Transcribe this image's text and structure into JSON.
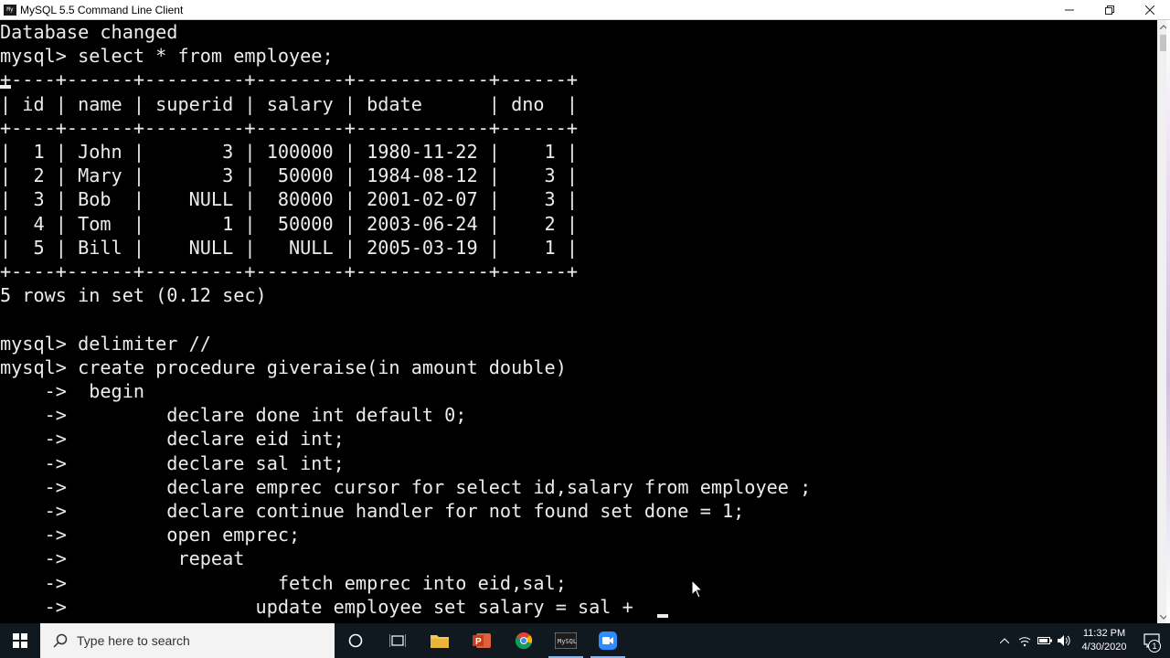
{
  "window": {
    "title": "MySQL 5.5 Command Line Client",
    "icon_label": "My"
  },
  "console": {
    "lines": [
      "Database changed",
      "mysql> select * from employee;",
      "+----+------+---------+--------+------------+------+",
      "| id | name | superid | salary | bdate      | dno  |",
      "+----+------+---------+--------+------------+------+",
      "|  1 | John |       3 | 100000 | 1980-11-22 |    1 |",
      "|  2 | Mary |       3 |  50000 | 1984-08-12 |    3 |",
      "|  3 | Bob  |    NULL |  80000 | 2001-02-07 |    3 |",
      "|  4 | Tom  |       1 |  50000 | 2003-06-24 |    2 |",
      "|  5 | Bill |    NULL |   NULL | 2005-03-19 |    1 |",
      "+----+------+---------+--------+------------+------+",
      "5 rows in set (0.12 sec)",
      "",
      "mysql> delimiter //",
      "mysql> create procedure giveraise(in amount double)",
      "    ->  begin",
      "    ->         declare done int default 0;",
      "    ->         declare eid int;",
      "    ->         declare sal int;",
      "    ->         declare emprec cursor for select id,salary from employee ;",
      "    ->         declare continue handler for not found set done = 1;",
      "    ->         open emprec;",
      "    ->          repeat",
      "    ->                   fetch emprec into eid,sal;",
      "    ->                 update employee set salary = sal +"
    ]
  },
  "taskbar": {
    "search_placeholder": "Type here to search",
    "apps": [
      "cortana",
      "task-view",
      "file-explorer",
      "powerpoint",
      "chrome",
      "mysql-console",
      "zoom"
    ],
    "clock_time": "11:32 PM",
    "clock_date": "4/30/2020",
    "notification_count": "1",
    "accent": "#0078d7"
  }
}
